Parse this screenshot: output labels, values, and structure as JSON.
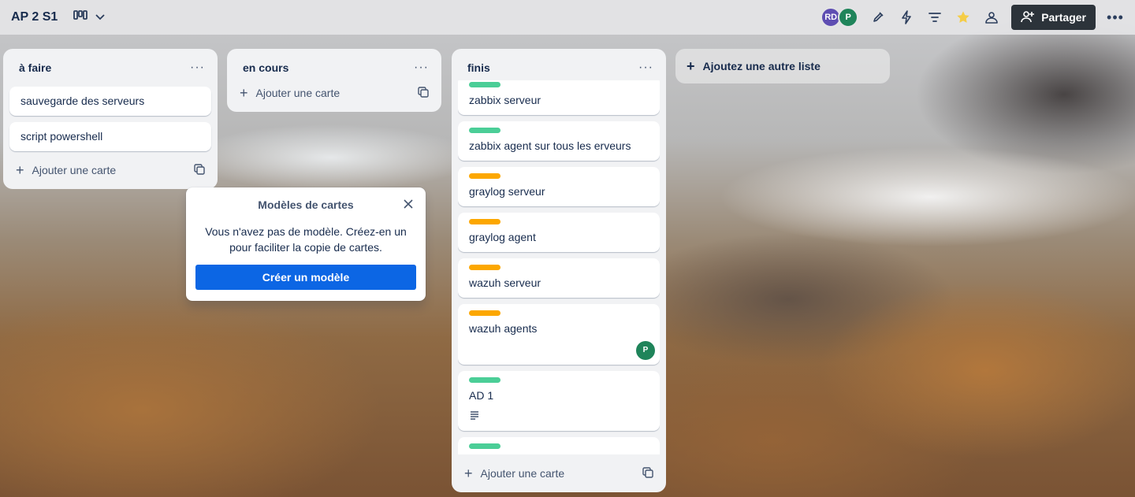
{
  "board": {
    "title": "AP 2 S1"
  },
  "header": {
    "share_label": "Partager",
    "members": [
      {
        "initials": "RD",
        "color": "#5e4db2"
      },
      {
        "initials": "P",
        "color": "#1f845a"
      }
    ],
    "star_color": "#f5cd47"
  },
  "lists": {
    "todo": {
      "title": "à faire",
      "cards": [
        "sauvegarde des serveurs",
        "script powershell"
      ],
      "add_label": "Ajouter une carte"
    },
    "doing": {
      "title": "en cours",
      "add_label": "Ajouter une carte"
    },
    "done": {
      "title": "finis",
      "cards": [
        {
          "title": "zabbix serveur",
          "label_color": "#4bce97"
        },
        {
          "title": "zabbix agent sur tous les erveurs",
          "label_color": "#4bce97"
        },
        {
          "title": "graylog serveur",
          "label_color": "#fca700"
        },
        {
          "title": "graylog agent",
          "label_color": "#fca700"
        },
        {
          "title": "wazuh serveur",
          "label_color": "#fca700"
        },
        {
          "title": "wazuh agents",
          "label_color": "#fca700",
          "member": "P"
        },
        {
          "title": "AD 1",
          "label_color": "#4bce97"
        }
      ],
      "add_label": "Ajouter une carte"
    }
  },
  "add_list_label": "Ajoutez une autre liste",
  "popover": {
    "title": "Modèles de cartes",
    "text": "Vous n'avez pas de modèle. Créez-en un pour faciliter la copie de cartes.",
    "button": "Créer un modèle"
  }
}
